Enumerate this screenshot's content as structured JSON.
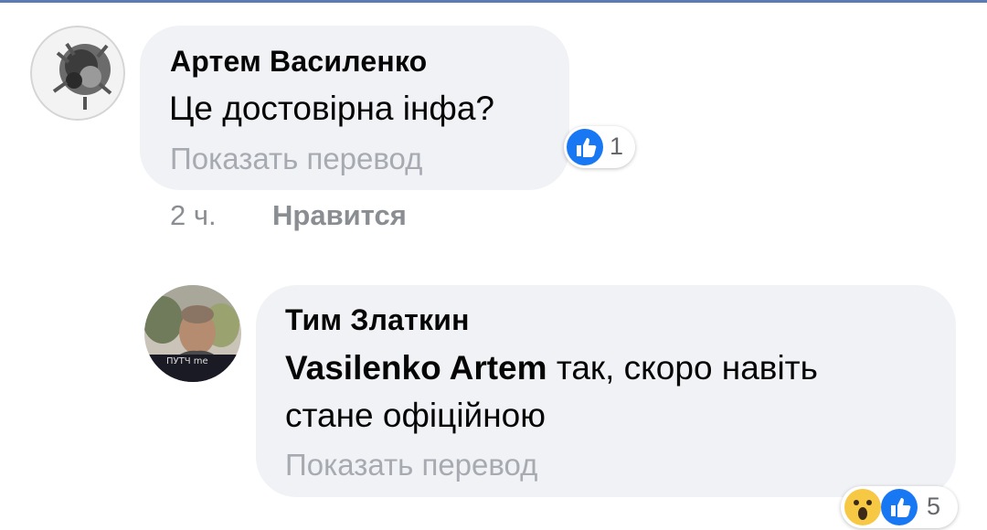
{
  "comments": [
    {
      "author": "Артем Василенко",
      "text": "Це достовірна інфа?",
      "translate_label": "Показать перевод",
      "time": "2 ч.",
      "like_label": "Нравится",
      "reactions": {
        "icons": [
          "like-icon"
        ],
        "count": "1"
      },
      "avatar_icon": "avatar-photo"
    },
    {
      "author": "Тим Златкин",
      "mention": "Vasilenko Artem",
      "text_line1": " так, скоро навіть",
      "text_line2": "стане офіційною",
      "translate_label": "Показать перевод",
      "reactions": {
        "icons": [
          "wow-icon",
          "like-icon"
        ],
        "count": "5"
      },
      "avatar_icon": "avatar-photo",
      "avatar_caption": "ПУТЧ me"
    }
  ],
  "colors": {
    "bubble": "#f0f2f5",
    "like_blue": "#1877f2",
    "meta_gray": "#8a8d91",
    "translate_gray": "#a7abb1",
    "wow_yellow": "#f7c843"
  }
}
